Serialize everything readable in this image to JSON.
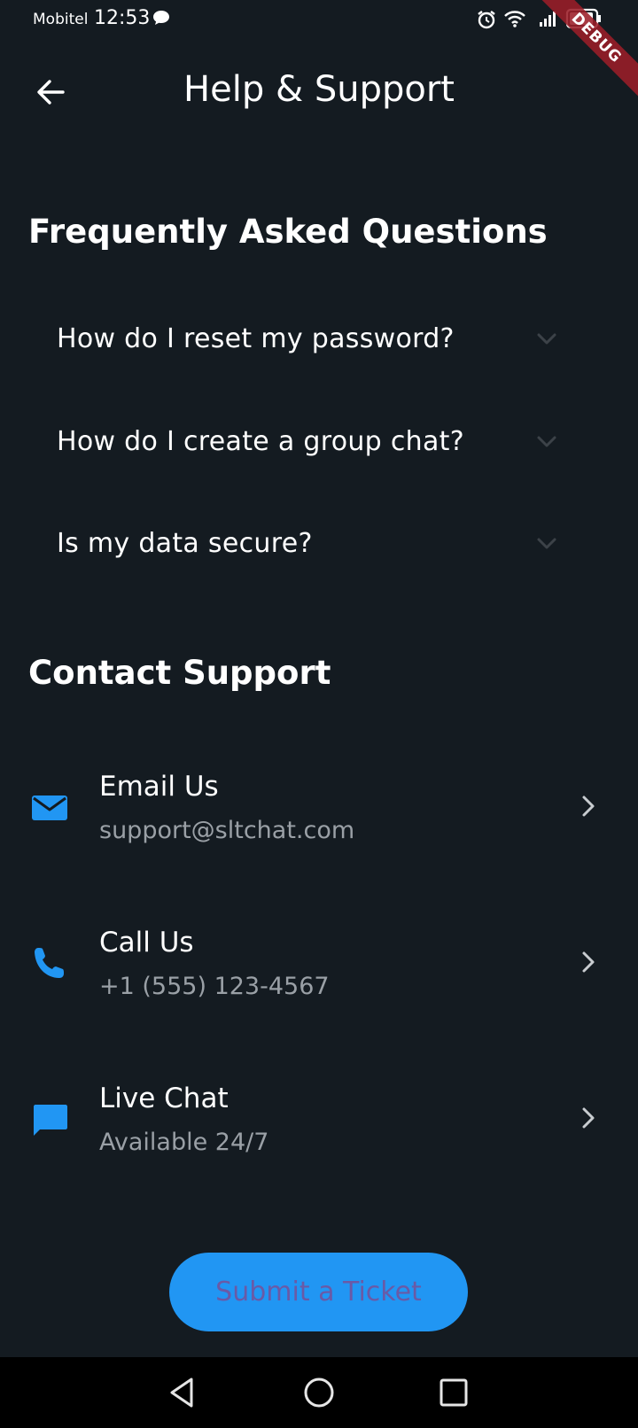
{
  "status_bar": {
    "carrier": "Mobitel",
    "time": "12:53",
    "icons": [
      "message-icon",
      "alarm-icon",
      "wifi-icon",
      "signal-icon",
      "battery-icon"
    ]
  },
  "debug_banner": "DEBUG",
  "app_bar": {
    "back_icon": "arrow-left-icon",
    "title": "Help & Support"
  },
  "faq": {
    "title": "Frequently Asked Questions",
    "items": [
      {
        "question": "How do I reset my password?",
        "icon": "chevron-down-icon"
      },
      {
        "question": "How do I create a group chat?",
        "icon": "chevron-down-icon"
      },
      {
        "question": "Is my data secure?",
        "icon": "chevron-down-icon"
      }
    ]
  },
  "contact": {
    "title": "Contact Support",
    "items": [
      {
        "title": "Email Us",
        "subtitle": "support@sltchat.com",
        "icon": "email-icon"
      },
      {
        "title": "Call Us",
        "subtitle": "+1 (555) 123-4567",
        "icon": "phone-icon"
      },
      {
        "title": "Live Chat",
        "subtitle": "Available 24/7",
        "icon": "chat-icon"
      }
    ]
  },
  "submit_button": {
    "label": "Submit a Ticket"
  },
  "colors": {
    "background": "#141b21",
    "accent": "#2196f3",
    "subtitle": "#9aa0a6",
    "button_text": "#6a5aa6",
    "debug_ribbon": "#9b1e28"
  },
  "nav_bar": {
    "icons": [
      "nav-back-icon",
      "nav-home-icon",
      "nav-recents-icon"
    ]
  }
}
